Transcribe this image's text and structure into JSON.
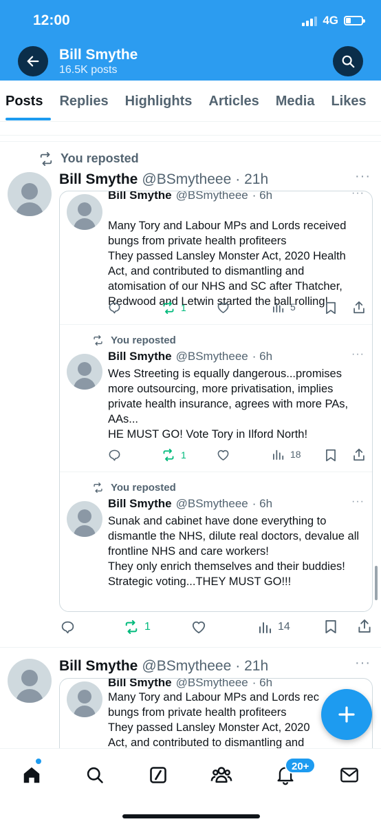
{
  "status_bar": {
    "time": "12:00",
    "network": "4G"
  },
  "header": {
    "name": "Bill Smythe",
    "posts_count": "16.5K posts"
  },
  "tabs": [
    {
      "label": "Posts",
      "active": true
    },
    {
      "label": "Replies",
      "active": false
    },
    {
      "label": "Highlights",
      "active": false
    },
    {
      "label": "Articles",
      "active": false
    },
    {
      "label": "Media",
      "active": false
    },
    {
      "label": "Likes",
      "active": false
    }
  ],
  "repost_label": "You reposted",
  "post1": {
    "author": "Bill Smythe",
    "handle": "@BSmytheee",
    "time": "· 21h",
    "thread": [
      {
        "author": "Bill Smythe",
        "handle": "@BSmytheee",
        "time": "· 6h",
        "text": "Many Tory and Labour MPs and Lords received bungs from private health profiteers\nThey passed Lansley Monster Act, 2020 Health Act, and contributed to dismantling and atomisation of our NHS and SC after Thatcher, Redwood and Letwin started the ball rolling!",
        "reposts": "1",
        "views": "5"
      },
      {
        "repost_label": "You reposted",
        "author": "Bill Smythe",
        "handle": "@BSmytheee",
        "time": "· 6h",
        "text": "Wes Streeting is equally dangerous...promises more outsourcing, more privatisation, implies private health insurance, agrees with more PAs, AAs...\nHE MUST GO! Vote Tory in Ilford North!",
        "reposts": "1",
        "views": "18"
      },
      {
        "repost_label": "You reposted",
        "author": "Bill Smythe",
        "handle": "@BSmytheee",
        "time": "· 6h",
        "text": "Sunak and cabinet have done everything to dismantle the NHS, dilute real doctors, devalue all frontline NHS and care workers!\nThey only enrich themselves and their buddies!\nStrategic voting...THEY MUST GO!!!"
      }
    ],
    "reposts": "1",
    "views": "14"
  },
  "post2": {
    "author": "Bill Smythe",
    "handle": "@BSmytheee",
    "time": "· 21h",
    "quoted": {
      "author": "Bill Smythe",
      "handle": "@BSmytheee",
      "time": "· 6h",
      "line1": "Many Tory and Labour MPs and Lords rec",
      "line2": "bungs from private health profiteers",
      "line3": "They passed Lansley Monster Act, 2020",
      "line4": "Act, and contributed to dismantling and"
    }
  },
  "bottom_nav": {
    "notifications_badge": "20+"
  },
  "colors": {
    "header_blue": "#2c9cf0",
    "accent": "#1d9bf0",
    "repost_green": "#00ba7c"
  }
}
